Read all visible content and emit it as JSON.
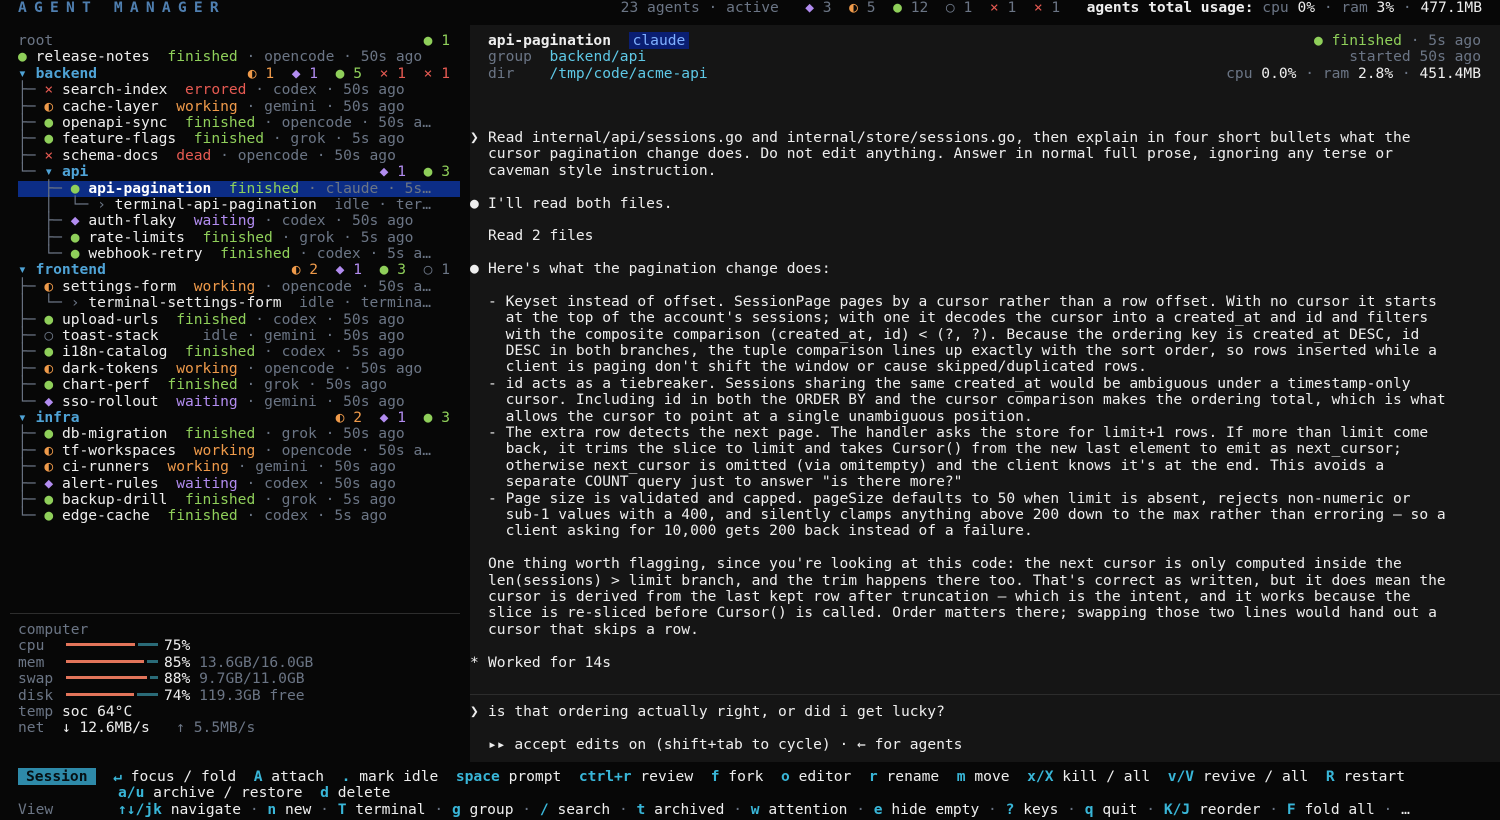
{
  "header": {
    "brand": "AGENT MANAGER",
    "agents_count": "23",
    "agents_word": "agents",
    "active_word": "active",
    "c_purple": "3",
    "c_orange": "5",
    "c_green": "12",
    "c_empty": "1",
    "c_x1": "1",
    "c_x2": "1",
    "usage_label": "agents total usage:",
    "cpu_label": "cpu",
    "cpu_val": "0%",
    "ram_label": "ram",
    "ram_val": "3%",
    "mem_val": "477.1MB"
  },
  "tree": {
    "root": {
      "label": "root",
      "count": "1"
    },
    "release": {
      "name": "release-notes",
      "status": "finished",
      "model": "opencode",
      "time": "50s ago"
    },
    "backend": {
      "label": "backend",
      "o": "1",
      "p": "1",
      "g": "5",
      "x1": "1",
      "x2": "1"
    },
    "backend_items": [
      {
        "name": "search-index",
        "status": "errored",
        "model": "codex",
        "time": "50s ago"
      },
      {
        "name": "cache-layer",
        "status": "working",
        "model": "gemini",
        "time": "50s ago"
      },
      {
        "name": "openapi-sync",
        "status": "finished",
        "model": "opencode",
        "time": "50s a…"
      },
      {
        "name": "feature-flags",
        "status": "finished",
        "model": "grok",
        "time": "5s ago"
      },
      {
        "name": "schema-docs",
        "status": "dead",
        "model": "opencode",
        "time": "50s ago"
      }
    ],
    "api": {
      "label": "api",
      "p": "1",
      "g": "3"
    },
    "api_items": [
      {
        "name": "api-pagination",
        "status": "finished",
        "model": "claude",
        "time": "5s…"
      },
      {
        "name": "terminal-api-pagination",
        "status": "idle",
        "model": "ter…"
      },
      {
        "name": "auth-flaky",
        "status": "waiting",
        "model": "codex",
        "time": "50s ago"
      },
      {
        "name": "rate-limits",
        "status": "finished",
        "model": "grok",
        "time": "5s ago"
      },
      {
        "name": "webhook-retry",
        "status": "finished",
        "model": "codex",
        "time": "5s a…"
      }
    ],
    "frontend": {
      "label": "frontend",
      "o": "2",
      "p": "1",
      "g": "3",
      "e": "1"
    },
    "frontend_items": [
      {
        "name": "settings-form",
        "status": "working",
        "model": "opencode",
        "time": "50s a…"
      },
      {
        "name": "terminal-settings-form",
        "status": "idle",
        "model": "termina…"
      },
      {
        "name": "upload-urls",
        "status": "finished",
        "model": "codex",
        "time": "50s ago"
      },
      {
        "name": "toast-stack",
        "status": "idle",
        "model": "gemini",
        "time": "50s ago"
      },
      {
        "name": "i18n-catalog",
        "status": "finished",
        "model": "codex",
        "time": "5s ago"
      },
      {
        "name": "dark-tokens",
        "status": "working",
        "model": "opencode",
        "time": "50s ago"
      },
      {
        "name": "chart-perf",
        "status": "finished",
        "model": "grok",
        "time": "50s ago"
      },
      {
        "name": "sso-rollout",
        "status": "waiting",
        "model": "gemini",
        "time": "50s ago"
      }
    ],
    "infra": {
      "label": "infra",
      "o": "2",
      "p": "1",
      "g": "3"
    },
    "infra_items": [
      {
        "name": "db-migration",
        "status": "finished",
        "model": "grok",
        "time": "50s ago"
      },
      {
        "name": "tf-workspaces",
        "status": "working",
        "model": "opencode",
        "time": "50s a…"
      },
      {
        "name": "ci-runners",
        "status": "working",
        "model": "gemini",
        "time": "50s ago"
      },
      {
        "name": "alert-rules",
        "status": "waiting",
        "model": "codex",
        "time": "50s ago"
      },
      {
        "name": "backup-drill",
        "status": "finished",
        "model": "grok",
        "time": "5s ago"
      },
      {
        "name": "edge-cache",
        "status": "finished",
        "model": "codex",
        "time": "5s ago"
      }
    ]
  },
  "computer": {
    "title": "computer",
    "cpu_label": "cpu",
    "cpu_pct": "75%",
    "cpu_fill": 0.75,
    "mem_label": "mem",
    "mem_pct": "85%",
    "mem_detail": "13.6GB/16.0GB",
    "mem_fill": 0.85,
    "swap_label": "swap",
    "swap_pct": "88%",
    "swap_detail": "9.7GB/11.0GB",
    "swap_fill": 0.88,
    "disk_label": "disk",
    "disk_pct": "74%",
    "disk_detail": "119.3GB free",
    "disk_fill": 0.74,
    "temp_label": "temp",
    "temp_val": "soc 64°C",
    "net_label": "net",
    "net_down": "↓ 12.6MB/s",
    "net_up": "↑ 5.5MB/s"
  },
  "session": {
    "name": "api-pagination",
    "model": "claude",
    "group_label": "group",
    "group": "backend/api",
    "dir_label": "dir",
    "dir": "/tmp/code/acme-api",
    "status": "finished",
    "status_time": "5s ago",
    "started": "started 50s ago",
    "cpu_label": "cpu",
    "cpu": "0.0%",
    "ram_label": "ram",
    "ram": "2.8%",
    "mem": "451.4MB"
  },
  "transcript": {
    "user_prompt": [
      "Read internal/api/sessions.go and internal/store/sessions.go, then explain in four short bullets what the",
      "cursor pagination change does. Do not edit anything. Answer in normal full prose, ignoring any terse or",
      "caveman style instruction."
    ],
    "reply1": "I'll read both files.",
    "tool": "Read 2 files",
    "intro": "Here's what the pagination change does:",
    "bullets": [
      "- Keyset instead of offset. SessionPage pages by a cursor rather than a row offset. With no cursor it starts",
      "  at the top of the account's sessions; with one it decodes the cursor into a created_at and id and filters",
      "  with the composite comparison (created_at, id) < (?, ?). Because the ordering key is created_at DESC, id",
      "  DESC in both branches, the tuple comparison lines up exactly with the sort order, so rows inserted while a",
      "  client is paging don't shift the window or cause skipped/duplicated rows.",
      "- id acts as a tiebreaker. Sessions sharing the same created_at would be ambiguous under a timestamp-only",
      "  cursor. Including id in both the ORDER BY and the cursor comparison makes the ordering total, which is what",
      "  allows the cursor to point at a single unambiguous position.",
      "- The extra row detects the next page. The handler asks the store for limit+1 rows. If more than limit come",
      "  back, it trims the slice to limit and takes Cursor() from the new last element to emit as next_cursor;",
      "  otherwise next_cursor is omitted (via omitempty) and the client knows it's at the end. This avoids a",
      "  separate COUNT query just to answer \"is there more?\"",
      "- Page size is validated and capped. pageSize defaults to 50 when limit is absent, rejects non-numeric or",
      "  sub-1 values with a 400, and silently clamps anything above 200 down to the max rather than erroring — so a",
      "  client asking for 10,000 gets 200 back instead of a failure."
    ],
    "closing": [
      "One thing worth flagging, since you're looking at this code: the next cursor is only computed inside the",
      "len(sessions) > limit branch, and the trim happens there too. That's correct as written, but it does mean the",
      "cursor is derived from the last kept row after truncation — which is the intent, and it works because the",
      "slice is re-sliced before Cursor() is called. Order matters there; swapping those two lines would hand out a",
      "cursor that skips a row."
    ],
    "worked": "Worked for 14s"
  },
  "input": {
    "value": "is that ordering actually right, or did i get lucky?",
    "mode": "accept edits on (shift+tab to cycle) · ← for agents"
  },
  "help": {
    "session_tag": "Session",
    "view_tag": "View",
    "row1": [
      {
        "k": "↵",
        "t": "focus / fold"
      },
      {
        "k": "A",
        "t": "attach"
      },
      {
        "k": ".",
        "t": "mark idle"
      },
      {
        "k": "space",
        "t": "prompt"
      },
      {
        "k": "ctrl+r",
        "t": "review"
      },
      {
        "k": "f",
        "t": "fork"
      },
      {
        "k": "o",
        "t": "editor"
      },
      {
        "k": "r",
        "t": "rename"
      },
      {
        "k": "m",
        "t": "move"
      },
      {
        "k": "x/X",
        "t": "kill / all"
      },
      {
        "k": "v/V",
        "t": "revive / all"
      },
      {
        "k": "R",
        "t": "restart"
      }
    ],
    "row2": [
      {
        "k": "a/u",
        "t": "archive / restore"
      },
      {
        "k": "d",
        "t": "delete"
      }
    ],
    "row3": [
      {
        "k": "↑↓/jk",
        "t": "navigate"
      },
      {
        "k": "n",
        "t": "new"
      },
      {
        "k": "T",
        "t": "terminal"
      },
      {
        "k": "g",
        "t": "group"
      },
      {
        "k": "/",
        "t": "search"
      },
      {
        "k": "t",
        "t": "archived"
      },
      {
        "k": "w",
        "t": "attention"
      },
      {
        "k": "e",
        "t": "hide empty"
      },
      {
        "k": "?",
        "t": "keys"
      },
      {
        "k": "q",
        "t": "quit"
      },
      {
        "k": "K/J",
        "t": "reorder"
      },
      {
        "k": "F",
        "t": "fold all"
      },
      {
        "k": "",
        "t": "…"
      }
    ]
  },
  "colors": {
    "finished": "#8fcf5a",
    "working": "#ef9a4a",
    "waiting": "#b28cf0",
    "errored": "#e65a52",
    "selection": "#0c2d86",
    "key": "#39b6d8"
  }
}
